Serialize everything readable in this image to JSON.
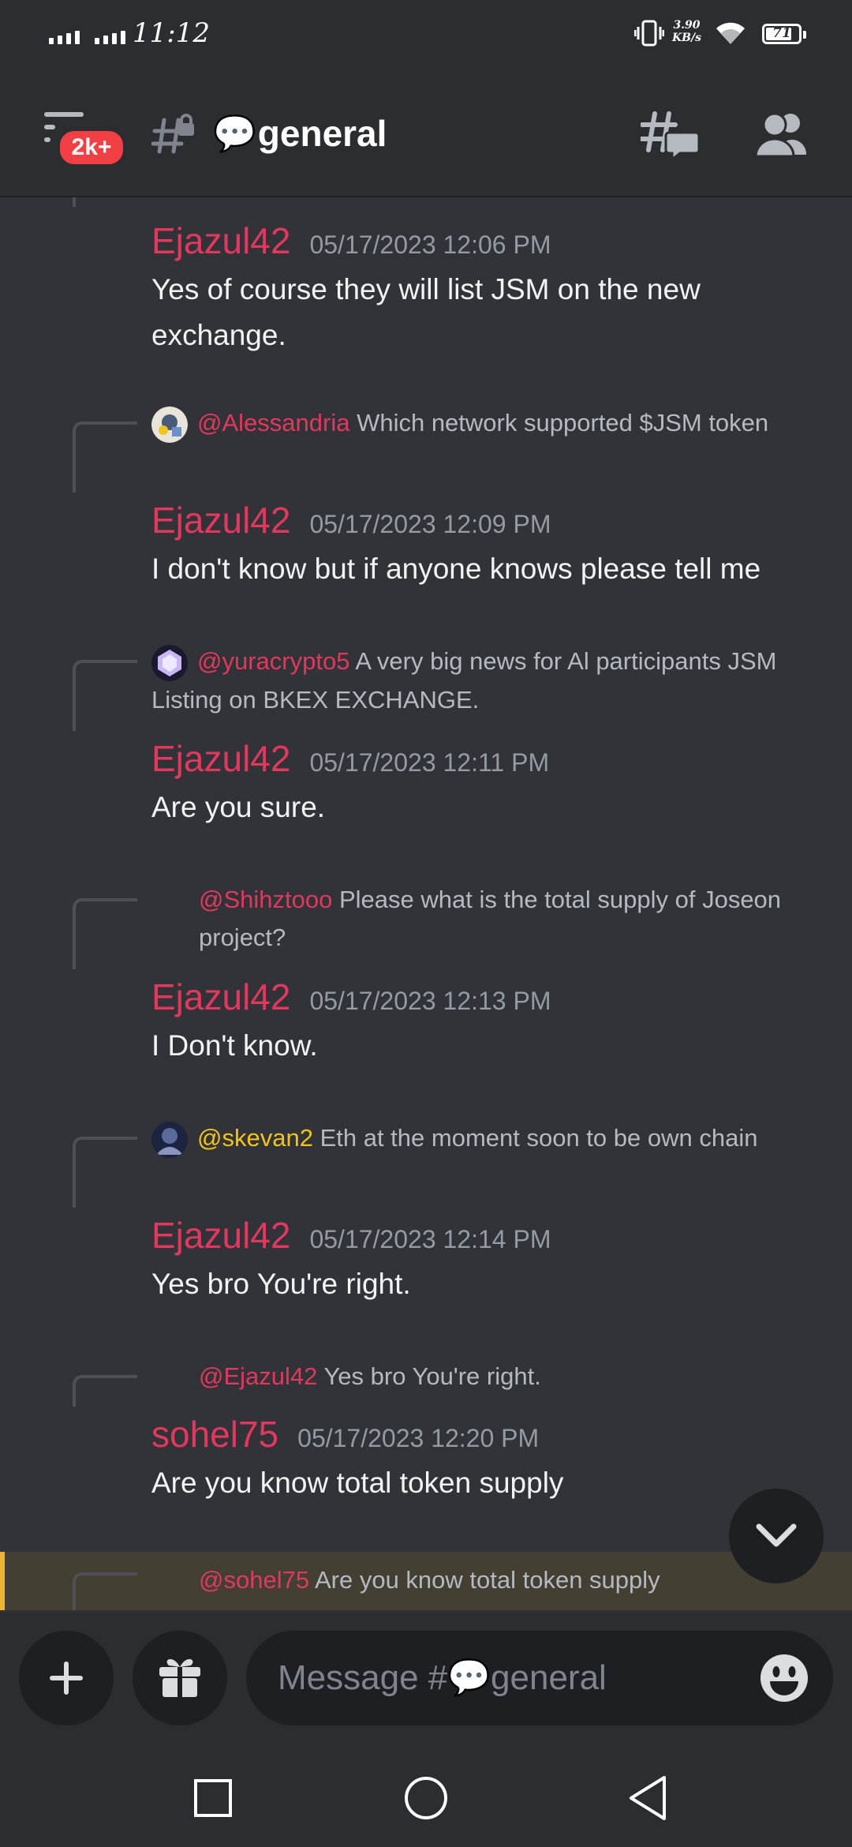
{
  "status_bar": {
    "time": "11:12",
    "net_speed_value": "3.90",
    "net_speed_unit": "KB/s",
    "battery": "71"
  },
  "header": {
    "badge": "2k+",
    "channel_emoji": "💬",
    "channel_name": "general"
  },
  "messages": [
    {
      "author": "Ejazul42",
      "timestamp": "05/17/2023 12:06 PM",
      "text": "Yes of course they will list JSM on the new exchange."
    },
    {
      "reply_mention": "@Alessandria",
      "reply_text": "Which network supported $JSM token",
      "author": "Ejazul42",
      "timestamp": "05/17/2023 12:09 PM",
      "text": "I don't know but if anyone knows please tell me"
    },
    {
      "reply_mention": "@yuracrypto5",
      "reply_text": "A very big news for Al participants JSM Listing on BKEX EXCHANGE.",
      "author": "Ejazul42",
      "timestamp": "05/17/2023 12:11 PM",
      "text": "Are you sure."
    },
    {
      "reply_mention": "@Shihztooo",
      "reply_text": "Please what is the total supply of Joseon project?",
      "author": "Ejazul42",
      "timestamp": "05/17/2023 12:13 PM",
      "text": "I Don't know."
    },
    {
      "reply_mention": "@skevan2",
      "reply_text": "Eth at the moment soon to be own chain",
      "author": "Ejazul42",
      "timestamp": "05/17/2023 12:14 PM",
      "text": "Yes bro You're right."
    },
    {
      "reply_mention": "@Ejazul42",
      "reply_text": "Yes bro You're right.",
      "author": "sohel75",
      "timestamp": "05/17/2023 12:20 PM",
      "text": "Are you know total token supply"
    },
    {
      "reply_mention": "@sohel75",
      "reply_text": "Are you know total token supply"
    }
  ],
  "composer": {
    "placeholder_prefix": "Message #",
    "placeholder_emoji": "💬",
    "placeholder_channel": "general"
  },
  "colors": {
    "background": "#313338",
    "header": "#2b2d31",
    "mention": "#e2385e",
    "mention_alt": "#f0c419",
    "badge": "#f23f43",
    "highlight_bar": "#f0b232"
  },
  "icons": {
    "menu": "hamburger-menu-icon",
    "locked_channel": "hash-lock-icon",
    "threads": "threads-icon",
    "members": "members-icon",
    "scroll_down": "chevron-down-icon",
    "add": "plus-icon",
    "gift": "gift-icon",
    "emoji": "smiley-icon"
  }
}
